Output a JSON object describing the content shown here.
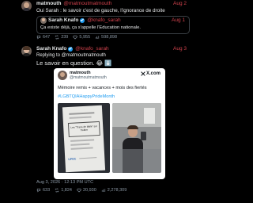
{
  "tweet1": {
    "name": "matmouth",
    "handle": "@matmoutmatmouth",
    "date": "Aug 2",
    "text": "Oui Sarah : le savoir c'est de gauche, l'ignorance de droite"
  },
  "quote": {
    "name": "Sarah Knafo",
    "handle": "@knafo_sarah",
    "date": "Aug 1",
    "text": "Ça existe déjà, ça s'appelle l'Education nationale.",
    "stats": [
      "647",
      "239",
      "5,955",
      "598,898"
    ]
  },
  "tweet2": {
    "name": "Sarah Knafo",
    "handle": "@knafo_sarah",
    "date": "Aug 3",
    "replying_to": "Replying to @matmoutmatmouth",
    "text": "Le savoir en question. 😂 ⬇️"
  },
  "embed": {
    "name": "matmouth",
    "handle": "@matmoutmatmouth",
    "brand": "X.com",
    "text": "Mémoire remis + vacances + mois des fiertés",
    "hashtag": "#LGBTQIAHappyPrideMonth",
    "doc_label": "UPEC",
    "doc_title": "Les \"Trans de bible\" sur Twitter"
  },
  "footer": {
    "timestamp": "Aug 3, 2026 · 12:13 PM UTC",
    "stats": [
      "633",
      "1,824",
      "20,930",
      "2,278,309"
    ]
  },
  "colors": {
    "accent": "#d0424c",
    "verified": "#1d9bf0",
    "hashtag": "#1d9bf0",
    "muted": "#8b98a5"
  },
  "icons": [
    "reply-icon",
    "retweet-icon",
    "like-icon",
    "views-icon",
    "verified-icon",
    "x-logo-icon"
  ]
}
